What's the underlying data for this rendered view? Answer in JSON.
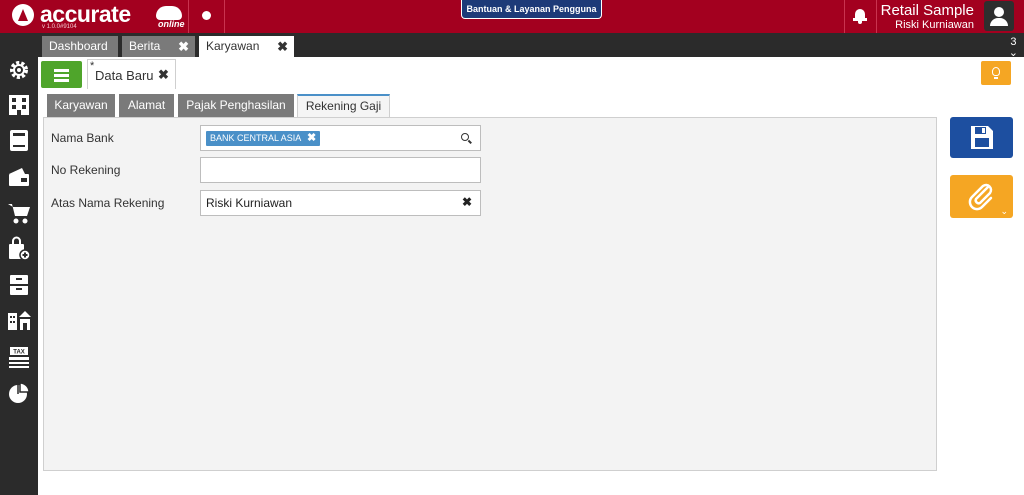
{
  "app": {
    "brand": "accurate",
    "brand_suffix": "online",
    "version": "v 1.0.0#9104",
    "help_button": "Bantuan & Layanan Pengguna",
    "company_name": "Retail Sample",
    "user_name": "Riski Kurniawan"
  },
  "sidebar": {
    "items": [
      {
        "icon": "settings-icon"
      },
      {
        "icon": "building-icon"
      },
      {
        "icon": "ledger-icon"
      },
      {
        "icon": "wallet-icon"
      },
      {
        "icon": "cart-icon"
      },
      {
        "icon": "shopping-bag-icon"
      },
      {
        "icon": "archive-icon"
      },
      {
        "icon": "warehouse-icon"
      },
      {
        "icon": "tax-icon"
      },
      {
        "icon": "pie-chart-icon"
      }
    ]
  },
  "doc_tabs": [
    {
      "label": "Dashboard",
      "closable": false
    },
    {
      "label": "Berita",
      "closable": true
    },
    {
      "label": "Karyawan",
      "closable": true,
      "active": true
    }
  ],
  "tab_count": "3",
  "sub_tab": {
    "modified_mark": "*",
    "label": "Data Baru"
  },
  "form_tabs": [
    {
      "label": "Karyawan"
    },
    {
      "label": "Alamat"
    },
    {
      "label": "Pajak Penghasilan"
    },
    {
      "label": "Rekening Gaji",
      "active": true
    }
  ],
  "form": {
    "bank_label": "Nama Bank",
    "bank_value": "BANK CENTRAL ASIA",
    "account_no_label": "No Rekening",
    "account_no_value": "",
    "account_name_label": "Atas Nama Rekening",
    "account_name_value": "Riski Kurniawan"
  },
  "colors": {
    "brand_red": "#a3001f",
    "sidebar_dark": "#2b2b2b",
    "list_green": "#4fa52b",
    "save_blue": "#1d4fa0",
    "attach_orange": "#f5a623",
    "chip_blue": "#4a90c8"
  }
}
